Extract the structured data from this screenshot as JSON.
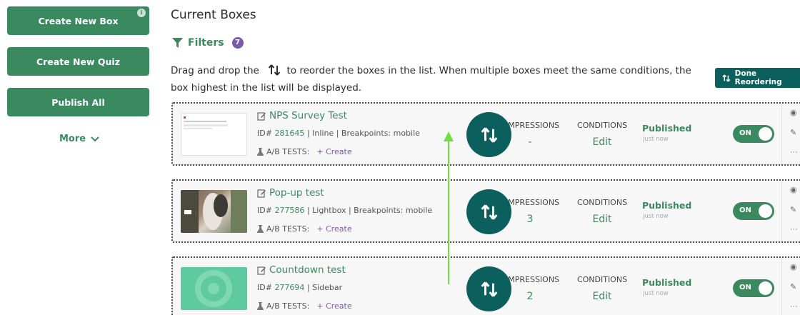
{
  "sidebar": {
    "create_box": "Create New Box",
    "create_quiz": "Create New Quiz",
    "publish_all": "Publish All",
    "more": "More",
    "info_badge": "i"
  },
  "main": {
    "title": "Current Boxes",
    "filters_label": "Filters",
    "filters_count": "7",
    "instructions_before": "Drag and drop the",
    "instructions_after": "to reorder the boxes in the list. When multiple boxes meet the same conditions, the box highest in the list will be displayed.",
    "done_button": "Done Reordering"
  },
  "boxes": [
    {
      "name": "NPS Survey Test",
      "id_label": "ID#",
      "id": "281645",
      "meta": "| Inline | Breakpoints: mobile",
      "ab_label": "A/B TESTS:",
      "ab_create": "+ Create",
      "impressions_label": "IMPRESSIONS",
      "impressions": "-",
      "conditions_label": "CONDITIONS",
      "conditions_action": "Edit",
      "status": "Published",
      "status_time": "just now",
      "toggle": "ON",
      "thumbnail": "survey"
    },
    {
      "name": "Pop-up test",
      "id_label": "ID#",
      "id": "277586",
      "meta": "| Lightbox | Breakpoints: mobile",
      "ab_label": "A/B TESTS:",
      "ab_create": "+ Create",
      "impressions_label": "IMPRESSIONS",
      "impressions": "3",
      "conditions_label": "CONDITIONS",
      "conditions_action": "Edit",
      "status": "Published",
      "status_time": "just now",
      "toggle": "ON",
      "thumbnail": "photo"
    },
    {
      "name": "Countdown test",
      "id_label": "ID#",
      "id": "277694",
      "meta": "| Sidebar",
      "ab_label": "A/B TESTS:",
      "ab_create": "+ Create",
      "impressions_label": "IMPRESSIONS",
      "impressions": "2",
      "conditions_label": "CONDITIONS",
      "conditions_action": "Edit",
      "status": "Published",
      "status_time": "just now",
      "toggle": "ON",
      "thumbnail": "countdown"
    }
  ],
  "colors": {
    "primary_green": "#3b8a5f",
    "dark_teal": "#0b5f5d",
    "purple": "#7a5aa8",
    "annotation_arrow": "#6ddf3f"
  },
  "icons": [
    "info-icon",
    "chevron-down-icon",
    "filter-icon",
    "sort-arrows-icon",
    "edit-icon",
    "flask-icon",
    "eye-icon",
    "pencil-icon",
    "more-icon"
  ]
}
